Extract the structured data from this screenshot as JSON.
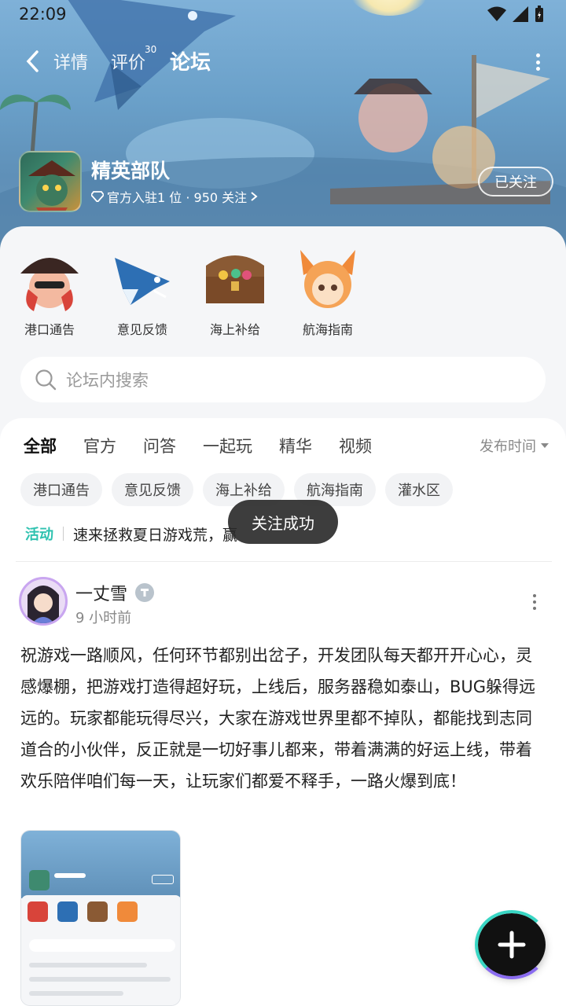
{
  "status_bar": {
    "time": "22:09"
  },
  "nav": {
    "tabs": [
      {
        "label": "详情"
      },
      {
        "label": "评价",
        "badge": "30"
      },
      {
        "label": "论坛",
        "active": true
      }
    ]
  },
  "forum": {
    "name": "精英部队",
    "meta": "官方入驻1 位 · 950 关注",
    "follow_label": "已关注"
  },
  "sections": [
    {
      "label": "港口通告",
      "icon": "pirate-girl-icon"
    },
    {
      "label": "意见反馈",
      "icon": "swordfish-icon"
    },
    {
      "label": "海上补给",
      "icon": "treasure-chest-icon"
    },
    {
      "label": "航海指南",
      "icon": "fox-girl-icon"
    }
  ],
  "search": {
    "placeholder": "论坛内搜索"
  },
  "filter_tabs": [
    {
      "label": "全部",
      "active": true
    },
    {
      "label": "官方"
    },
    {
      "label": "问答"
    },
    {
      "label": "一起玩"
    },
    {
      "label": "精华"
    },
    {
      "label": "视频"
    }
  ],
  "sort": {
    "label": "发布时间"
  },
  "chips": [
    "港口通告",
    "意见反馈",
    "海上补给",
    "航海指南",
    "灌水区"
  ],
  "activity": {
    "tag": "活动",
    "text": "速来拯救夏日游戏荒，赢"
  },
  "toast": {
    "text": "关注成功"
  },
  "post": {
    "author": "一丈雪",
    "time": "9 小时前",
    "body": "祝游戏一路顺风，任何环节都别出岔子，开发团队每天都开开心心，灵感爆棚，把游戏打造得超好玩，上线后，服务器稳如泰山，BUG躲得远远的。玩家都能玩得尽兴，大家在游戏世界里都不掉队，都能找到志同道合的小伙伴，反正就是一切好事儿都来，带着满满的好运上线，带着欢乐陪伴咱们每一天，让玩家们都爱不释手，一路火爆到底！"
  },
  "colors": {
    "accent": "#39d6c4",
    "activity": "#2fc2b0"
  }
}
